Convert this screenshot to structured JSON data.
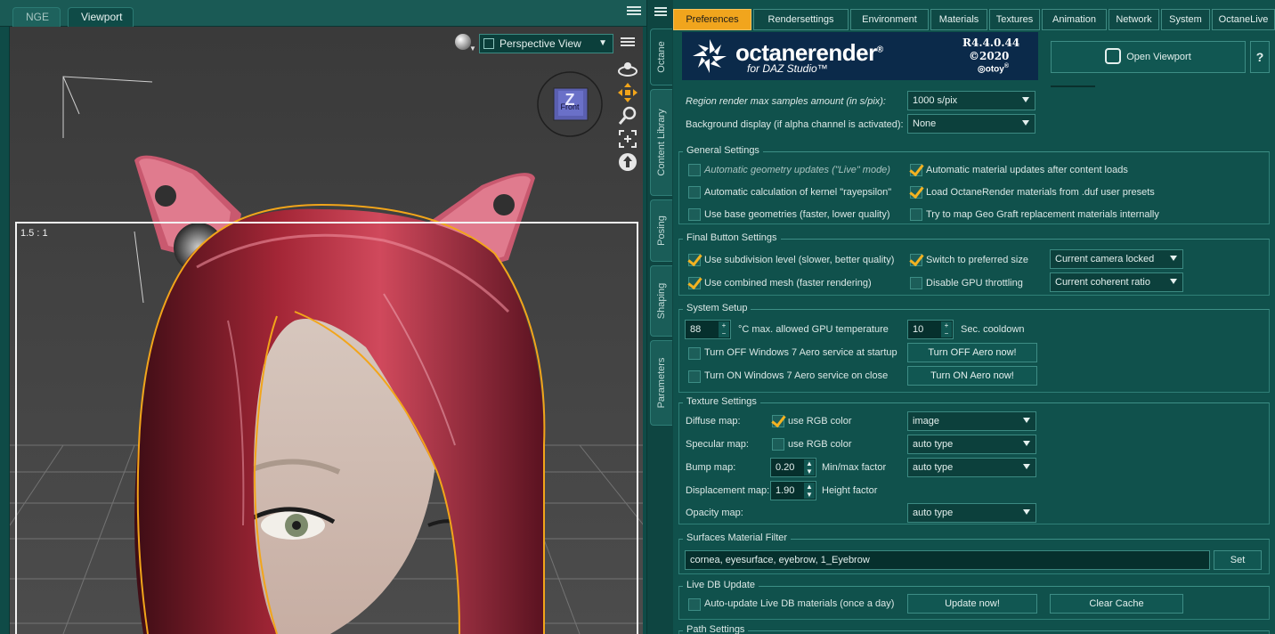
{
  "viewport_pane": {
    "tabs": [
      "NGE",
      "Viewport"
    ],
    "view_selector": "Perspective View",
    "ratio_label": "1.5 : 1",
    "cube_labels": {
      "top": "Z",
      "front": "Front"
    }
  },
  "side_tabs": [
    "Octane",
    "Content Library",
    "Posing",
    "Shaping",
    "Parameters"
  ],
  "top_tabs": [
    "Preferences",
    "Rendersettings",
    "Environment",
    "Materials",
    "Textures",
    "Animation",
    "Network",
    "System",
    "OctaneLive"
  ],
  "active_top_tab": "Preferences",
  "banner": {
    "logo": "octanerender",
    "reg": "®",
    "sub": "for DAZ Studio™",
    "version": "R4.4.0.44",
    "copyright": "©2020",
    "brand": "otoy"
  },
  "open_viewport_label": "Open Viewport",
  "help_label": "?",
  "render_settings": {
    "region_samples_label": "Region render max samples amount (in s/pix):",
    "region_samples_value": "1000 s/pix",
    "background_label": "Background display (if alpha channel is activated):",
    "background_value": "None"
  },
  "general_settings": {
    "title": "General Settings",
    "items": [
      {
        "label": "Automatic geometry updates (\"Live\" mode)",
        "checked": false,
        "disabled": true
      },
      {
        "label": "Automatic material updates after content loads",
        "checked": true
      },
      {
        "label": "Automatic calculation of kernel \"rayepsilon\"",
        "checked": false
      },
      {
        "label": "Load OctaneRender materials from .duf user presets",
        "checked": true
      },
      {
        "label": "Use base geometries (faster, lower quality)",
        "checked": false
      },
      {
        "label": "Try to map Geo Graft replacement materials internally",
        "checked": false
      }
    ]
  },
  "final_button_settings": {
    "title": "Final Button Settings",
    "subdivision_label": "Use subdivision level (slower, better quality)",
    "preferred_size_label": "Switch to preferred size",
    "camera_combo": "Current camera locked",
    "combined_mesh_label": "Use combined mesh (faster rendering)",
    "gpu_throttling_label": "Disable GPU throttling",
    "ratio_combo": "Current coherent ratio"
  },
  "system_setup": {
    "title": "System Setup",
    "gpu_temp_value": "88",
    "gpu_temp_label": "°C max. allowed GPU temperature",
    "cooldown_value": "10",
    "cooldown_label": "Sec. cooldown",
    "aero_off_label": "Turn OFF Windows 7 Aero service at startup",
    "aero_off_button": "Turn OFF Aero now!",
    "aero_on_label": "Turn ON Windows 7 Aero service on close",
    "aero_on_button": "Turn ON Aero now!"
  },
  "texture_settings": {
    "title": "Texture Settings",
    "diffuse_label": "Diffuse map:",
    "diffuse_rgb": "use RGB color",
    "diffuse_combo": "image",
    "specular_label": "Specular map:",
    "specular_rgb": "use RGB color",
    "specular_combo": "auto type",
    "bump_label": "Bump map:",
    "bump_value": "0.20",
    "bump_factor_label": "Min/max factor",
    "bump_combo": "auto type",
    "displacement_label": "Displacement map:",
    "displacement_value": "1.90",
    "displacement_factor_label": "Height factor",
    "opacity_label": "Opacity map:",
    "opacity_combo": "auto type"
  },
  "surfaces_filter": {
    "title": "Surfaces Material Filter",
    "value": "cornea, eyesurface, eyebrow, 1_Eyebrow",
    "set_button": "Set"
  },
  "live_db": {
    "title": "Live DB Update",
    "auto_update_label": "Auto-update Live DB materials (once a day)",
    "update_button": "Update now!",
    "clear_button": "Clear Cache"
  },
  "path_settings_title": "Path Settings",
  "colors": {
    "accent": "#f1a51d",
    "panel_bg": "#10514c",
    "banner_bg": "#0b2a4a",
    "hair": "#8e1f2e",
    "selection_outline": "#f2a51a"
  }
}
